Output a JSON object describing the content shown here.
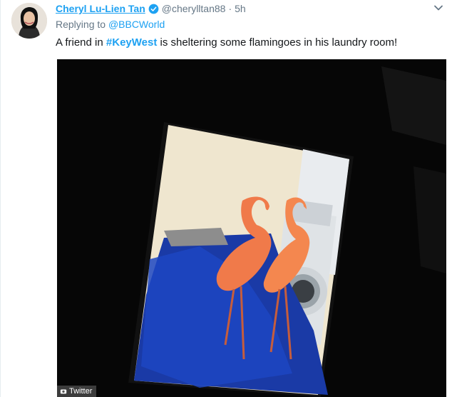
{
  "tweet": {
    "author_name": "Cheryl Lu-Lien Tan",
    "handle": "@cherylltan88",
    "separator": "·",
    "time": "5h",
    "replying_prefix": "Replying to",
    "replying_to": "@BBCWorld",
    "text_before": "A friend in ",
    "hashtag": "#KeyWest",
    "text_after": " is sheltering some flamingoes in his laundry room!",
    "icons": [
      "avatar",
      "verified-badge-icon",
      "chevron-down-icon"
    ]
  },
  "media": {
    "description_icon": "photo",
    "watermark_label": "Twitter",
    "colors": {
      "accent": "#1da1f2",
      "muted": "#657786",
      "tarp": "#1a3aa6",
      "flamingo": "#f07a4a"
    }
  }
}
